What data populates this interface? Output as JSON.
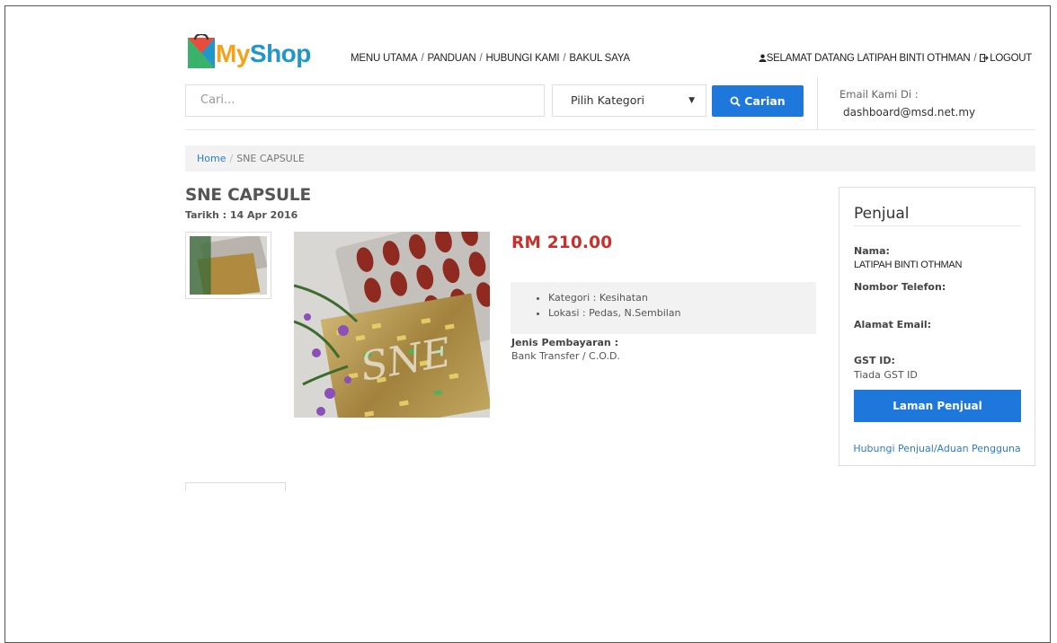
{
  "brand": {
    "my": "My",
    "shop": "Shop"
  },
  "nav": {
    "items": [
      "MENU UTAMA",
      "PANDUAN",
      "HUBUNGI KAMI",
      "BAKUL SAYA"
    ],
    "separator": "/"
  },
  "user": {
    "greeting": "SELAMAT DATANG LATIPAH BINTI OTHMAN",
    "separator": "/",
    "logout": "LOGOUT"
  },
  "search": {
    "placeholder": "Cari...",
    "category_selected": "Pilih Kategori",
    "button_label": "Carian"
  },
  "contact": {
    "label": "Email Kami Di :",
    "email": "dashboard@msd.net.my"
  },
  "breadcrumb": {
    "home": "Home",
    "separator": "/",
    "current": "SNE CAPSULE"
  },
  "product": {
    "title": "SNE CAPSULE",
    "date": "Tarikh : 14 Apr 2016",
    "price": "RM 210.00",
    "details": [
      "Kategori : Kesihatan",
      "Lokasi : Pedas, N.Sembilan"
    ],
    "payment_label": "Jenis Pembayaran :",
    "payment_value": "Bank Transfer / C.O.D.",
    "image_text": "SNE"
  },
  "seller": {
    "title": "Penjual",
    "name_label": "Nama:",
    "name_value": "LATIPAH BINTI OTHMAN",
    "phone_label": "Nombor Telefon:",
    "email_label": "Alamat Email:",
    "gst_label": "GST ID:",
    "gst_value": "Tiada GST ID",
    "button_label": "Laman Penjual",
    "contact_link": "Hubungi Penjual",
    "link_separator": "/",
    "report_link": "Aduan Pengguna"
  },
  "colors": {
    "accent": "#1e78dc",
    "price": "#c9302c",
    "link": "#2b7bd9",
    "logo_orange": "#f4a11b",
    "logo_blue": "#2196c9"
  }
}
